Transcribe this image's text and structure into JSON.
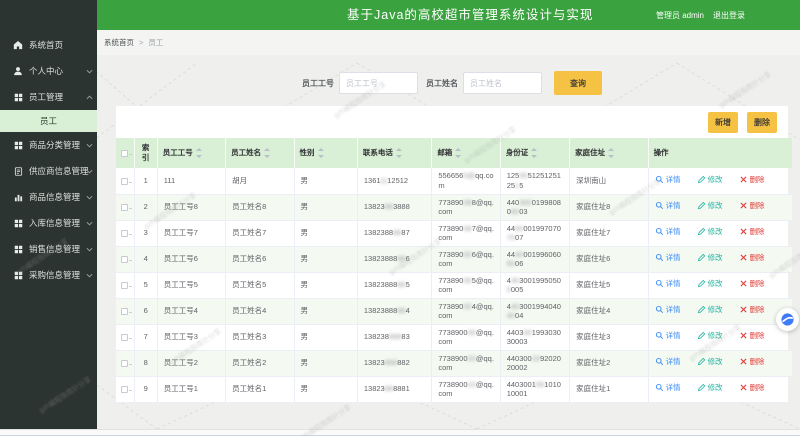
{
  "header": {
    "title": "基于Java的高校超市管理系统设计与实现",
    "user": "管理员 admin",
    "logout": "退出登录"
  },
  "sidebar": {
    "items": [
      {
        "id": "home",
        "label": "系统首页",
        "icon": "home",
        "chevron": null
      },
      {
        "id": "profile",
        "label": "个人中心",
        "icon": "user",
        "chevron": "down"
      },
      {
        "id": "employee-mgmt",
        "label": "员工管理",
        "icon": "grid",
        "chevron": "up",
        "children": [
          {
            "id": "employee",
            "label": "员工",
            "active": true
          }
        ]
      },
      {
        "id": "category-mgmt",
        "label": "商品分类管理",
        "icon": "grid",
        "chevron": "down"
      },
      {
        "id": "supplier-mgmt",
        "label": "供应商信息管理",
        "icon": "doc",
        "chevron": "down"
      },
      {
        "id": "goods-mgmt",
        "label": "商品信息管理",
        "icon": "chart",
        "chevron": "down"
      },
      {
        "id": "inbound-mgmt",
        "label": "入库信息管理",
        "icon": "grid",
        "chevron": "down"
      },
      {
        "id": "sales-mgmt",
        "label": "销售信息管理",
        "icon": "grid",
        "chevron": "down"
      },
      {
        "id": "purchase-mgmt",
        "label": "采购信息管理",
        "icon": "grid",
        "chevron": "down"
      }
    ]
  },
  "breadcrumb": {
    "root": "系统首页",
    "separator": ">",
    "current": "员工"
  },
  "search": {
    "fields": [
      {
        "label": "员工工号",
        "placeholder": "员工工号"
      },
      {
        "label": "员工姓名",
        "placeholder": "员工姓名"
      }
    ],
    "submit": "查询"
  },
  "toolbar": {
    "add": "新增",
    "delete": "删除"
  },
  "table": {
    "columns": [
      {
        "key": "select",
        "label": "",
        "checkbox": true
      },
      {
        "key": "index",
        "label": "索引"
      },
      {
        "key": "no",
        "label": "员工工号",
        "sortable": true
      },
      {
        "key": "name",
        "label": "员工姓名",
        "sortable": true
      },
      {
        "key": "gender",
        "label": "性别",
        "sortable": true
      },
      {
        "key": "phone",
        "label": "联系电话",
        "sortable": true
      },
      {
        "key": "email",
        "label": "邮箱",
        "sortable": true
      },
      {
        "key": "idcard",
        "label": "身份证",
        "sortable": true
      },
      {
        "key": "address",
        "label": "家庭住址",
        "sortable": true
      },
      {
        "key": "ops",
        "label": "操作"
      }
    ],
    "actions": {
      "detail": "详情",
      "edit": "修改",
      "remove": "删除"
    },
    "rows": [
      {
        "index": "1",
        "no": "111",
        "name": "胡月",
        "gender": "男",
        "phone": [
          {
            "t": "1361"
          },
          {
            "t": "11",
            "b": 1
          },
          {
            "t": "12512"
          }
        ],
        "email": [
          {
            "t": "556656"
          },
          {
            "t": "5@",
            "b": 1
          },
          {
            "t": "qq.com"
          }
        ],
        "idcard": [
          {
            "t": "125"
          },
          {
            "t": "55",
            "b": 1
          },
          {
            "t": "5125125125"
          },
          {
            "t": "1",
            "b": 1
          },
          {
            "t": "5"
          }
        ],
        "address": "深圳南山"
      },
      {
        "index": "2",
        "no": "员工工号8",
        "name": "员工姓名8",
        "gender": "男",
        "phone": [
          {
            "t": "13823"
          },
          {
            "t": "88",
            "b": 1
          },
          {
            "t": "3888"
          }
        ],
        "email": [
          {
            "t": "773890"
          },
          {
            "t": "08",
            "b": 1
          },
          {
            "t": "8@qq.com"
          }
        ],
        "idcard": [
          {
            "t": "440"
          },
          {
            "t": "300",
            "b": 1
          },
          {
            "t": "01998080"
          },
          {
            "t": "80",
            "b": 1
          },
          {
            "t": "03"
          }
        ],
        "address": "家庭住址8"
      },
      {
        "index": "3",
        "no": "员工工号7",
        "name": "员工姓名7",
        "gender": "男",
        "phone": [
          {
            "t": "1382388"
          },
          {
            "t": "88",
            "b": 1
          },
          {
            "t": "87"
          }
        ],
        "email": [
          {
            "t": "773890"
          },
          {
            "t": "08",
            "b": 1
          },
          {
            "t": "7@qq.com"
          }
        ],
        "idcard": [
          {
            "t": "44"
          },
          {
            "t": "60",
            "b": 1
          },
          {
            "t": "001997070"
          },
          {
            "t": "70",
            "b": 1
          },
          {
            "t": "07"
          }
        ],
        "address": "家庭住址7"
      },
      {
        "index": "4",
        "no": "员工工号6",
        "name": "员工姓名6",
        "gender": "男",
        "phone": [
          {
            "t": "13823888"
          },
          {
            "t": "88",
            "b": 1
          },
          {
            "t": "6"
          }
        ],
        "email": [
          {
            "t": "773890"
          },
          {
            "t": "00",
            "b": 1
          },
          {
            "t": "6@qq.com"
          }
        ],
        "idcard": [
          {
            "t": "44"
          },
          {
            "t": "40",
            "b": 1
          },
          {
            "t": "001996060"
          },
          {
            "t": "60",
            "b": 1
          },
          {
            "t": "06"
          }
        ],
        "address": "家庭住址6"
      },
      {
        "index": "5",
        "no": "员工工号5",
        "name": "员工姓名5",
        "gender": "男",
        "phone": [
          {
            "t": "13823888"
          },
          {
            "t": "88",
            "b": 1
          },
          {
            "t": "5"
          }
        ],
        "email": [
          {
            "t": "773890"
          },
          {
            "t": "00",
            "b": 1
          },
          {
            "t": "5@qq.com"
          }
        ],
        "idcard": [
          {
            "t": "4"
          },
          {
            "t": "40",
            "b": 1
          },
          {
            "t": "3001995050"
          },
          {
            "t": "5",
            "b": 1
          },
          {
            "t": "005"
          }
        ],
        "address": "家庭住址5"
      },
      {
        "index": "6",
        "no": "员工工号4",
        "name": "员工姓名4",
        "gender": "男",
        "phone": [
          {
            "t": "13823888"
          },
          {
            "t": "88",
            "b": 1
          },
          {
            "t": "4"
          }
        ],
        "email": [
          {
            "t": "773890"
          },
          {
            "t": "00",
            "b": 1
          },
          {
            "t": "4@qq.com"
          }
        ],
        "idcard": [
          {
            "t": "4"
          },
          {
            "t": "40",
            "b": 1
          },
          {
            "t": "3001994040"
          },
          {
            "t": "40",
            "b": 1
          },
          {
            "t": "04"
          }
        ],
        "address": "家庭住址4"
      },
      {
        "index": "7",
        "no": "员工工号3",
        "name": "员工姓名3",
        "gender": "男",
        "phone": [
          {
            "t": "138238"
          },
          {
            "t": "888",
            "b": 1
          },
          {
            "t": "83"
          }
        ],
        "email": [
          {
            "t": "7738900"
          },
          {
            "t": "30",
            "b": 1
          },
          {
            "t": "@qq.com"
          }
        ],
        "idcard": [
          {
            "t": "4403"
          },
          {
            "t": "00",
            "b": 1
          },
          {
            "t": "1993030"
          },
          {
            "t": "30003"
          }
        ],
        "address": "家庭住址3"
      },
      {
        "index": "8",
        "no": "员工工号2",
        "name": "员工姓名2",
        "gender": "男",
        "phone": [
          {
            "t": "13823"
          },
          {
            "t": "888",
            "b": 1
          },
          {
            "t": "882"
          }
        ],
        "email": [
          {
            "t": "7738900"
          },
          {
            "t": "20",
            "b": 1
          },
          {
            "t": "@qq.com"
          }
        ],
        "idcard": [
          {
            "t": "440300"
          },
          {
            "t": "19",
            "b": 1
          },
          {
            "t": "92020"
          },
          {
            "t": "20002"
          }
        ],
        "address": "家庭住址2"
      },
      {
        "index": "9",
        "no": "员工工号1",
        "name": "员工姓名1",
        "gender": "男",
        "phone": [
          {
            "t": "13823"
          },
          {
            "t": "88",
            "b": 1
          },
          {
            "t": "8881"
          }
        ],
        "email": [
          {
            "t": "7738900"
          },
          {
            "t": "10",
            "b": 1
          },
          {
            "t": "@qq.com"
          }
        ],
        "idcard": [
          {
            "t": "4403001"
          },
          {
            "t": "99",
            "b": 1
          },
          {
            "t": "1010"
          },
          {
            "t": "10001"
          }
        ],
        "address": "家庭住址1"
      }
    ]
  },
  "watermark": "gzh编程指南针分享",
  "colors": {
    "topbar_green": "#3aa23e",
    "table_header_green": "#d9efd6",
    "sidebar_dark": "#2c3431",
    "button_amber": "#f6c243",
    "detail_blue": "#3e8ef7",
    "edit_teal": "#26b3a0",
    "delete_red": "#e23c39"
  }
}
